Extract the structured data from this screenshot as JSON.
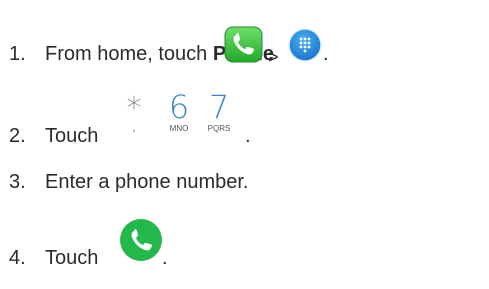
{
  "steps": [
    {
      "number": "1.",
      "text": "From home, touch ",
      "bold_text": "Phone",
      "separator": ">",
      "period": ".",
      "icons": [
        "phone-app-icon",
        "dialpad-icon"
      ]
    },
    {
      "number": "2.",
      "text": "Touch",
      "period": ".",
      "keys": [
        {
          "main": "*",
          "sub": ","
        },
        {
          "main": "6",
          "sub": "MNO"
        },
        {
          "main": "7",
          "sub": "PQRS"
        }
      ]
    },
    {
      "number": "3.",
      "text": "Enter a phone number."
    },
    {
      "number": "4.",
      "text": "Touch",
      "period": ".",
      "icons": [
        "call-button-icon"
      ]
    }
  ],
  "colors": {
    "text": "#2b2b2b",
    "phone_green": "#3cc43c",
    "dialpad_blue": "#2a8bdc",
    "key_blue": "#3d86c6",
    "call_green": "#22b84a"
  }
}
